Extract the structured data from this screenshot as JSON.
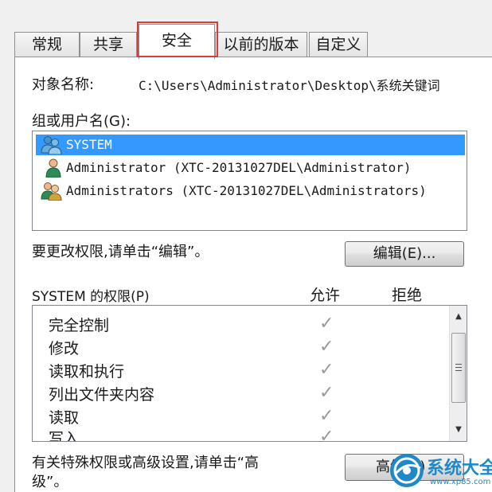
{
  "tabs": [
    "常规",
    "共享",
    "安全",
    "以前的版本",
    "自定义"
  ],
  "active_tab": "安全",
  "object_name": {
    "label": "对象名称:",
    "value": "C:\\Users\\Administrator\\Desktop\\系统关键词"
  },
  "groups": {
    "label": "组或用户名(G):",
    "items": [
      {
        "name": "SYSTEM",
        "icon": "group-users-icon",
        "selected": true
      },
      {
        "name": "Administrator (XTC-20131027DEL\\Administrator)",
        "icon": "user-icon",
        "selected": false
      },
      {
        "name": "Administrators (XTC-20131027DEL\\Administrators)",
        "icon": "group-users-icon",
        "selected": false
      }
    ]
  },
  "edit_hint": "要更改权限,请单击“编辑”。",
  "edit_button": "编辑(E)...",
  "permissions": {
    "label": "SYSTEM 的权限(P)",
    "allow_header": "允许",
    "deny_header": "拒绝",
    "items": [
      {
        "name": "完全控制",
        "allow": true,
        "deny": false
      },
      {
        "name": "修改",
        "allow": true,
        "deny": false
      },
      {
        "name": "读取和执行",
        "allow": true,
        "deny": false
      },
      {
        "name": "列出文件夹内容",
        "allow": true,
        "deny": false
      },
      {
        "name": "读取",
        "allow": true,
        "deny": false
      },
      {
        "name": "写入",
        "allow": true,
        "deny": false
      }
    ]
  },
  "advanced_hint": [
    "有关特殊权限或高级设置,请单击“高",
    "级”。"
  ],
  "advanced_button": "高级(V)",
  "watermark": {
    "title": "系统大全",
    "url": "www.xp85.com"
  },
  "colors": {
    "selection": "#3399ff",
    "tab_highlight": "#e0393a",
    "watermark": "#1e88c8"
  }
}
